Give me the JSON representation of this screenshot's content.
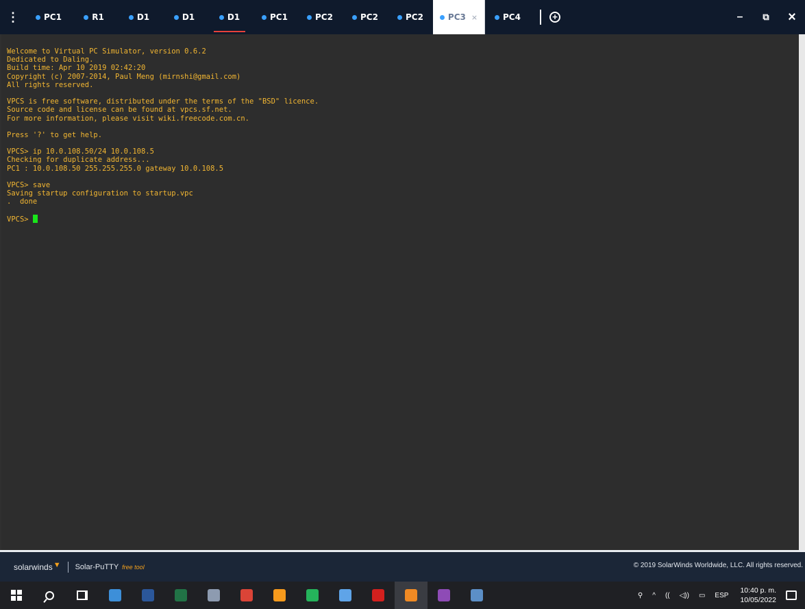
{
  "tabbar": {
    "menu_glyph": "⋮",
    "tabs": [
      {
        "label": "PC1",
        "active": false,
        "underlined": false
      },
      {
        "label": "R1",
        "active": false,
        "underlined": false
      },
      {
        "label": "D1",
        "active": false,
        "underlined": false
      },
      {
        "label": "D1",
        "active": false,
        "underlined": false
      },
      {
        "label": "D1",
        "active": false,
        "underlined": true
      },
      {
        "label": "PC1",
        "active": false,
        "underlined": false
      },
      {
        "label": "PC2",
        "active": false,
        "underlined": false
      },
      {
        "label": "PC2",
        "active": false,
        "underlined": false
      },
      {
        "label": "PC2",
        "active": false,
        "underlined": false
      },
      {
        "label": "PC3",
        "active": true,
        "underlined": false
      },
      {
        "label": "PC4",
        "active": false,
        "underlined": false
      }
    ],
    "active_close": "×",
    "new_tab_glyph": "+",
    "window_controls": {
      "minimize": "–",
      "restore": "⧉",
      "close": "×"
    }
  },
  "terminal": {
    "lines": [
      "Welcome to Virtual PC Simulator, version 0.6.2",
      "Dedicated to Daling.",
      "Build time: Apr 10 2019 02:42:20",
      "Copyright (c) 2007-2014, Paul Meng (mirnshi@gmail.com)",
      "All rights reserved.",
      "",
      "VPCS is free software, distributed under the terms of the \"BSD\" licence.",
      "Source code and license can be found at vpcs.sf.net.",
      "For more information, please visit wiki.freecode.com.cn.",
      "",
      "Press '?' to get help.",
      "",
      "VPCS> ip 10.0.108.50/24 10.0.108.5",
      "Checking for duplicate address...",
      "PC1 : 10.0.108.50 255.255.255.0 gateway 10.0.108.5",
      "",
      "VPCS> save",
      "Saving startup configuration to startup.vpc",
      ".  done",
      ""
    ],
    "prompt": "VPCS> "
  },
  "footer": {
    "brand": "solarwinds",
    "product": "Solar-PuTTY",
    "free_tool": "free tool",
    "copyright": "© 2019 SolarWinds Worldwide, LLC. All rights reserved."
  },
  "taskbar": {
    "apps": [
      {
        "name": "file-explorer-icon",
        "color": "#3d8fd9"
      },
      {
        "name": "word-icon",
        "color": "#2b579a"
      },
      {
        "name": "excel-icon",
        "color": "#217346"
      },
      {
        "name": "snipping-tool-icon",
        "color": "#8d9bb0"
      },
      {
        "name": "chrome-icon",
        "color": "#db4437"
      },
      {
        "name": "firefox-icon",
        "color": "#f79a1c"
      },
      {
        "name": "vmware-icon",
        "color": "#25b35b"
      },
      {
        "name": "gns3-icon",
        "color": "#5fa4e8"
      },
      {
        "name": "acrobat-icon",
        "color": "#d4201e"
      },
      {
        "name": "solar-putty-icon",
        "color": "#f08a24"
      },
      {
        "name": "winrar-icon",
        "color": "#8e4bb6"
      },
      {
        "name": "virtualbox-icon",
        "color": "#5c8fc7"
      }
    ],
    "active_app_index": 9,
    "tray": {
      "people": "⚲",
      "chevron": "^",
      "wifi": "((",
      "volume": "◁))",
      "keyboard": "▭",
      "language": "ESP",
      "time": "10:40 p. m.",
      "date": "10/05/2022"
    }
  }
}
